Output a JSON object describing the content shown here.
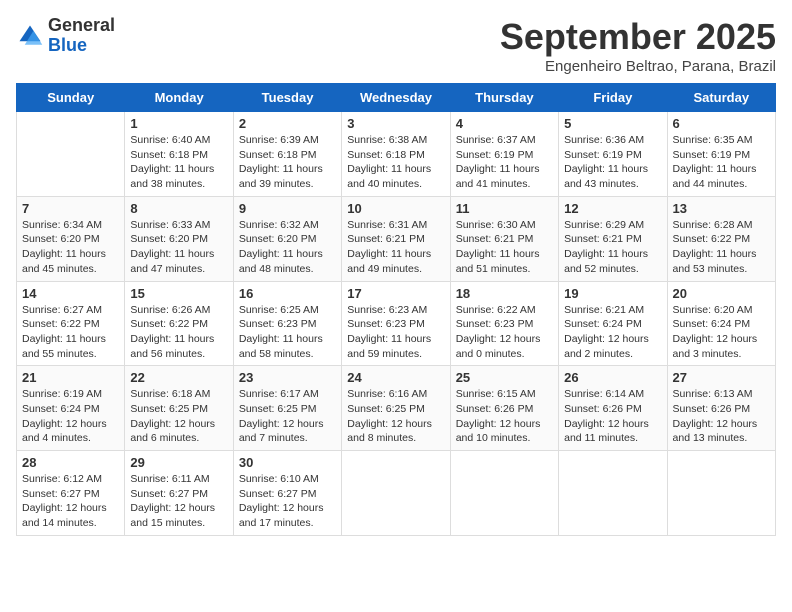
{
  "header": {
    "logo_general": "General",
    "logo_blue": "Blue",
    "month_title": "September 2025",
    "location": "Engenheiro Beltrao, Parana, Brazil"
  },
  "days_of_week": [
    "Sunday",
    "Monday",
    "Tuesday",
    "Wednesday",
    "Thursday",
    "Friday",
    "Saturday"
  ],
  "weeks": [
    [
      {
        "day": "",
        "info": ""
      },
      {
        "day": "1",
        "info": "Sunrise: 6:40 AM\nSunset: 6:18 PM\nDaylight: 11 hours\nand 38 minutes."
      },
      {
        "day": "2",
        "info": "Sunrise: 6:39 AM\nSunset: 6:18 PM\nDaylight: 11 hours\nand 39 minutes."
      },
      {
        "day": "3",
        "info": "Sunrise: 6:38 AM\nSunset: 6:18 PM\nDaylight: 11 hours\nand 40 minutes."
      },
      {
        "day": "4",
        "info": "Sunrise: 6:37 AM\nSunset: 6:19 PM\nDaylight: 11 hours\nand 41 minutes."
      },
      {
        "day": "5",
        "info": "Sunrise: 6:36 AM\nSunset: 6:19 PM\nDaylight: 11 hours\nand 43 minutes."
      },
      {
        "day": "6",
        "info": "Sunrise: 6:35 AM\nSunset: 6:19 PM\nDaylight: 11 hours\nand 44 minutes."
      }
    ],
    [
      {
        "day": "7",
        "info": "Sunrise: 6:34 AM\nSunset: 6:20 PM\nDaylight: 11 hours\nand 45 minutes."
      },
      {
        "day": "8",
        "info": "Sunrise: 6:33 AM\nSunset: 6:20 PM\nDaylight: 11 hours\nand 47 minutes."
      },
      {
        "day": "9",
        "info": "Sunrise: 6:32 AM\nSunset: 6:20 PM\nDaylight: 11 hours\nand 48 minutes."
      },
      {
        "day": "10",
        "info": "Sunrise: 6:31 AM\nSunset: 6:21 PM\nDaylight: 11 hours\nand 49 minutes."
      },
      {
        "day": "11",
        "info": "Sunrise: 6:30 AM\nSunset: 6:21 PM\nDaylight: 11 hours\nand 51 minutes."
      },
      {
        "day": "12",
        "info": "Sunrise: 6:29 AM\nSunset: 6:21 PM\nDaylight: 11 hours\nand 52 minutes."
      },
      {
        "day": "13",
        "info": "Sunrise: 6:28 AM\nSunset: 6:22 PM\nDaylight: 11 hours\nand 53 minutes."
      }
    ],
    [
      {
        "day": "14",
        "info": "Sunrise: 6:27 AM\nSunset: 6:22 PM\nDaylight: 11 hours\nand 55 minutes."
      },
      {
        "day": "15",
        "info": "Sunrise: 6:26 AM\nSunset: 6:22 PM\nDaylight: 11 hours\nand 56 minutes."
      },
      {
        "day": "16",
        "info": "Sunrise: 6:25 AM\nSunset: 6:23 PM\nDaylight: 11 hours\nand 58 minutes."
      },
      {
        "day": "17",
        "info": "Sunrise: 6:23 AM\nSunset: 6:23 PM\nDaylight: 11 hours\nand 59 minutes."
      },
      {
        "day": "18",
        "info": "Sunrise: 6:22 AM\nSunset: 6:23 PM\nDaylight: 12 hours\nand 0 minutes."
      },
      {
        "day": "19",
        "info": "Sunrise: 6:21 AM\nSunset: 6:24 PM\nDaylight: 12 hours\nand 2 minutes."
      },
      {
        "day": "20",
        "info": "Sunrise: 6:20 AM\nSunset: 6:24 PM\nDaylight: 12 hours\nand 3 minutes."
      }
    ],
    [
      {
        "day": "21",
        "info": "Sunrise: 6:19 AM\nSunset: 6:24 PM\nDaylight: 12 hours\nand 4 minutes."
      },
      {
        "day": "22",
        "info": "Sunrise: 6:18 AM\nSunset: 6:25 PM\nDaylight: 12 hours\nand 6 minutes."
      },
      {
        "day": "23",
        "info": "Sunrise: 6:17 AM\nSunset: 6:25 PM\nDaylight: 12 hours\nand 7 minutes."
      },
      {
        "day": "24",
        "info": "Sunrise: 6:16 AM\nSunset: 6:25 PM\nDaylight: 12 hours\nand 8 minutes."
      },
      {
        "day": "25",
        "info": "Sunrise: 6:15 AM\nSunset: 6:26 PM\nDaylight: 12 hours\nand 10 minutes."
      },
      {
        "day": "26",
        "info": "Sunrise: 6:14 AM\nSunset: 6:26 PM\nDaylight: 12 hours\nand 11 minutes."
      },
      {
        "day": "27",
        "info": "Sunrise: 6:13 AM\nSunset: 6:26 PM\nDaylight: 12 hours\nand 13 minutes."
      }
    ],
    [
      {
        "day": "28",
        "info": "Sunrise: 6:12 AM\nSunset: 6:27 PM\nDaylight: 12 hours\nand 14 minutes."
      },
      {
        "day": "29",
        "info": "Sunrise: 6:11 AM\nSunset: 6:27 PM\nDaylight: 12 hours\nand 15 minutes."
      },
      {
        "day": "30",
        "info": "Sunrise: 6:10 AM\nSunset: 6:27 PM\nDaylight: 12 hours\nand 17 minutes."
      },
      {
        "day": "",
        "info": ""
      },
      {
        "day": "",
        "info": ""
      },
      {
        "day": "",
        "info": ""
      },
      {
        "day": "",
        "info": ""
      }
    ]
  ]
}
